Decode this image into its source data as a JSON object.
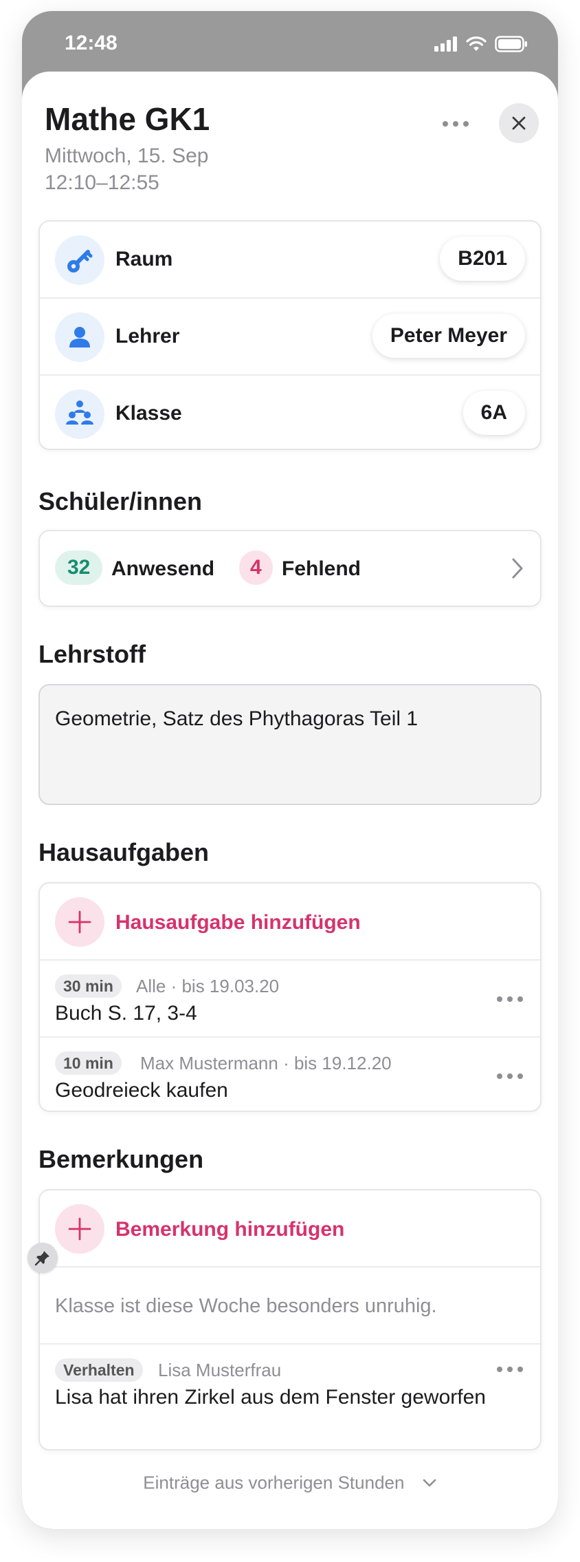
{
  "status_bar": {
    "time": "12:48"
  },
  "header": {
    "title": "Mathe GK1",
    "date": "Mittwoch, 15. Sep",
    "time_range": "12:10–12:55"
  },
  "info": [
    {
      "label": "Raum",
      "value": "B201",
      "icon": "key-icon"
    },
    {
      "label": "Lehrer",
      "value": "Peter Meyer",
      "icon": "person-icon"
    },
    {
      "label": "Klasse",
      "value": "6A",
      "icon": "group-icon"
    }
  ],
  "students": {
    "title": "Schüler/innen",
    "present_count": "32",
    "present_label": "Anwesend",
    "absent_count": "4",
    "absent_label": "Fehlend"
  },
  "lehrstoff": {
    "title": "Lehrstoff",
    "text": "Geometrie, Satz des Phythagoras Teil 1"
  },
  "homework": {
    "title": "Hausaufgaben",
    "add_label": "Hausaufgabe hinzufügen",
    "items": [
      {
        "duration": "30 min",
        "meta": "Alle · bis 19.03.20",
        "text": "Buch S. 17, 3-4"
      },
      {
        "duration": "10 min",
        "meta": "Max Mustermann · bis 19.12.20",
        "text": "Geodreieck kaufen"
      }
    ]
  },
  "remarks": {
    "title": "Bemerkungen",
    "add_label": "Bemerkung hinzufügen",
    "pinned_text": "Klasse ist diese Woche besonders unruhig.",
    "items": [
      {
        "tag": "Verhalten",
        "meta": "Lisa Musterfrau",
        "text": "Lisa hat ihren Zirkel aus dem Fenster geworfen"
      }
    ]
  },
  "footer": {
    "label": "Einträge aus vorherigen Stunden"
  },
  "colors": {
    "accent_pink": "#d6336c",
    "accent_blue": "#2f7be8",
    "accent_green": "#1a8c6f"
  }
}
